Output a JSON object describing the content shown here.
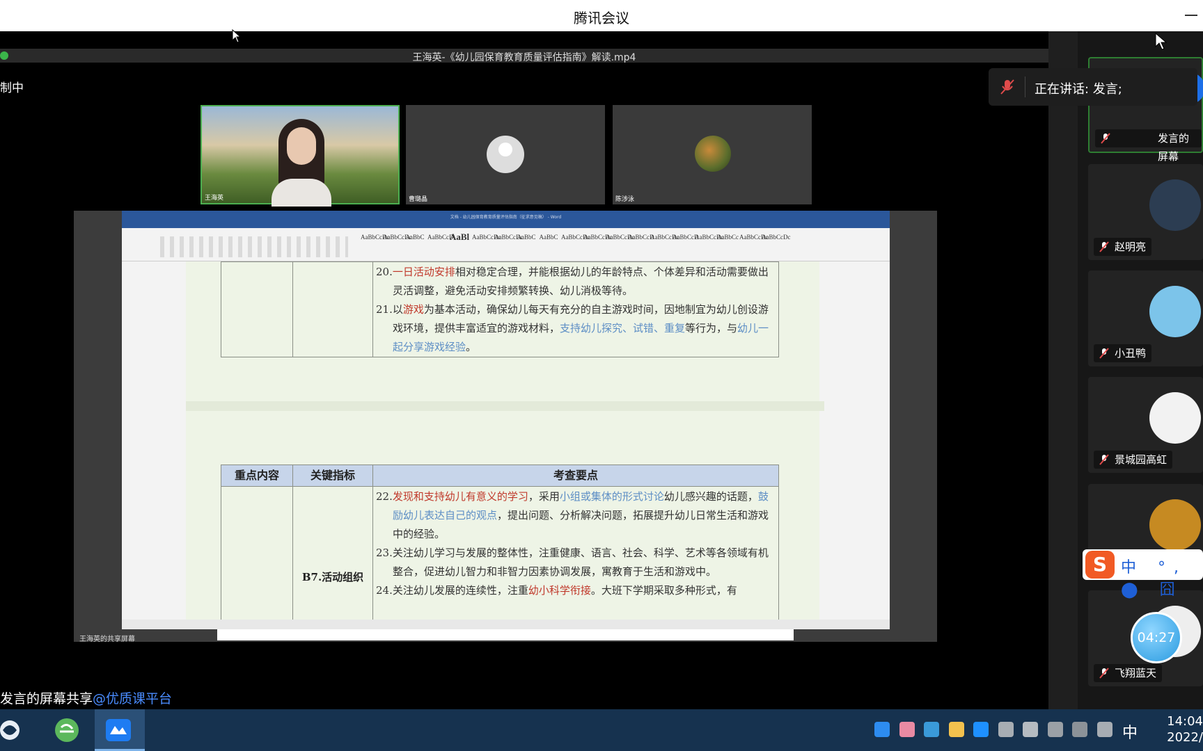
{
  "window": {
    "title": "腾讯会议"
  },
  "stage": {
    "video_title": "王海英-《幼儿园保育教育质量评估指南》解读.mp4",
    "recording_label": "制中",
    "participants": [
      {
        "name": "王海英"
      },
      {
        "name": "曹璐晶"
      },
      {
        "name": "陈涉泳"
      }
    ],
    "shared_label": "王海英的共享屏幕",
    "word_title": "文档 - 幼儿园保育教育质量评估指南（征求意见稿） - Word",
    "ribbon_styles": [
      "AaBbCcDc",
      "AaBbCcDc",
      "AaBbC",
      "AaBbCcD",
      "AaBl",
      "AaBbCcDc",
      "AaBbCcDc",
      "AaBbC",
      "AaBbC",
      "AaBbCcDc",
      "AaBbCcDc",
      "AaBbCcDc",
      "AaBbCcD",
      "AaBbCcDc",
      "AaBbCcD",
      "AaBbCcDc",
      "AaBbCc",
      "AaBbCcDc",
      "AaBbCcDc"
    ],
    "upper_items": [
      {
        "num": "20.",
        "parts": [
          [
            "一日活动安排",
            "red"
          ],
          [
            "相对稳定合理，并能根据幼儿的年龄特点、个体差异和活动需要做出灵活调整，避免活动安排频繁转换、幼儿消极等待。",
            ""
          ]
        ]
      },
      {
        "num": "21.",
        "parts": [
          [
            "以",
            ""
          ],
          [
            "游戏",
            "red"
          ],
          [
            "为基本活动，确保幼儿每天有充分的自主游戏时间，因地制宜为幼儿创设游戏环境，提供丰富适宜的游戏材料，",
            ""
          ],
          [
            "支持幼儿探究、试错、重复",
            "blue"
          ],
          [
            "等行为，与",
            ""
          ],
          [
            "幼儿一起分享游戏经验",
            "blue"
          ],
          [
            "。",
            ""
          ]
        ]
      }
    ],
    "table_headers": [
      "重点内容",
      "关键指标",
      "考查要点"
    ],
    "indicator": "B7.活动组织",
    "lower_items": [
      {
        "num": "22.",
        "parts": [
          [
            "发现和支持幼儿有意义的学习",
            "red"
          ],
          [
            "，采用",
            ""
          ],
          [
            "小组或集体的形式讨论",
            "blue"
          ],
          [
            "幼儿感兴趣的话题，",
            ""
          ],
          [
            "鼓励幼儿表达自己的观点",
            "blue"
          ],
          [
            "，提出问题、分析解决问题，拓展提升幼儿日常生活和游戏中的经验。",
            ""
          ]
        ]
      },
      {
        "num": "23.",
        "parts": [
          [
            "关注幼儿学习与发展的整体性，注重健康、语言、社会、科学、艺术等各领域有机整合，促进幼儿智力和非智力因素协调发展，寓教育于生活和游戏中。",
            ""
          ]
        ]
      },
      {
        "num": "24.",
        "parts": [
          [
            "关注幼儿发展的连续性，注重",
            ""
          ],
          [
            "幼小科学衔接",
            "red"
          ],
          [
            "。大班下学期采取多种形式，有",
            ""
          ]
        ]
      }
    ]
  },
  "bottom_caption": {
    "text": "发言的屏幕共享",
    "mention": "@优质课平台"
  },
  "speaking": {
    "text": "正在讲话: 发言;"
  },
  "panel": {
    "cards": [
      {
        "name": "发言的屏幕",
        "color": "#1d6fe8"
      },
      {
        "name": "赵明亮",
        "color": "#2c3d52"
      },
      {
        "name": "小丑鸭",
        "color": "#7cc4ea"
      },
      {
        "name": "景城园高虹",
        "color": "#f2f2f2"
      },
      {
        "name": "",
        "color": "#c68a22"
      },
      {
        "name": "飞翔蓝天",
        "color": "#eeeeee"
      }
    ]
  },
  "timer": "04:27",
  "ime": {
    "logo": "S",
    "items": "中 °, ⬤ 囧"
  },
  "taskbar": {
    "ime_zh": "中",
    "clock_time": "14:04",
    "clock_date": "2022/"
  },
  "colors": {
    "accent_blue": "#4a8cff",
    "highlight_red": "#c0392b",
    "highlight_blue": "#5d8ec5",
    "taskbar": "#16324f"
  }
}
